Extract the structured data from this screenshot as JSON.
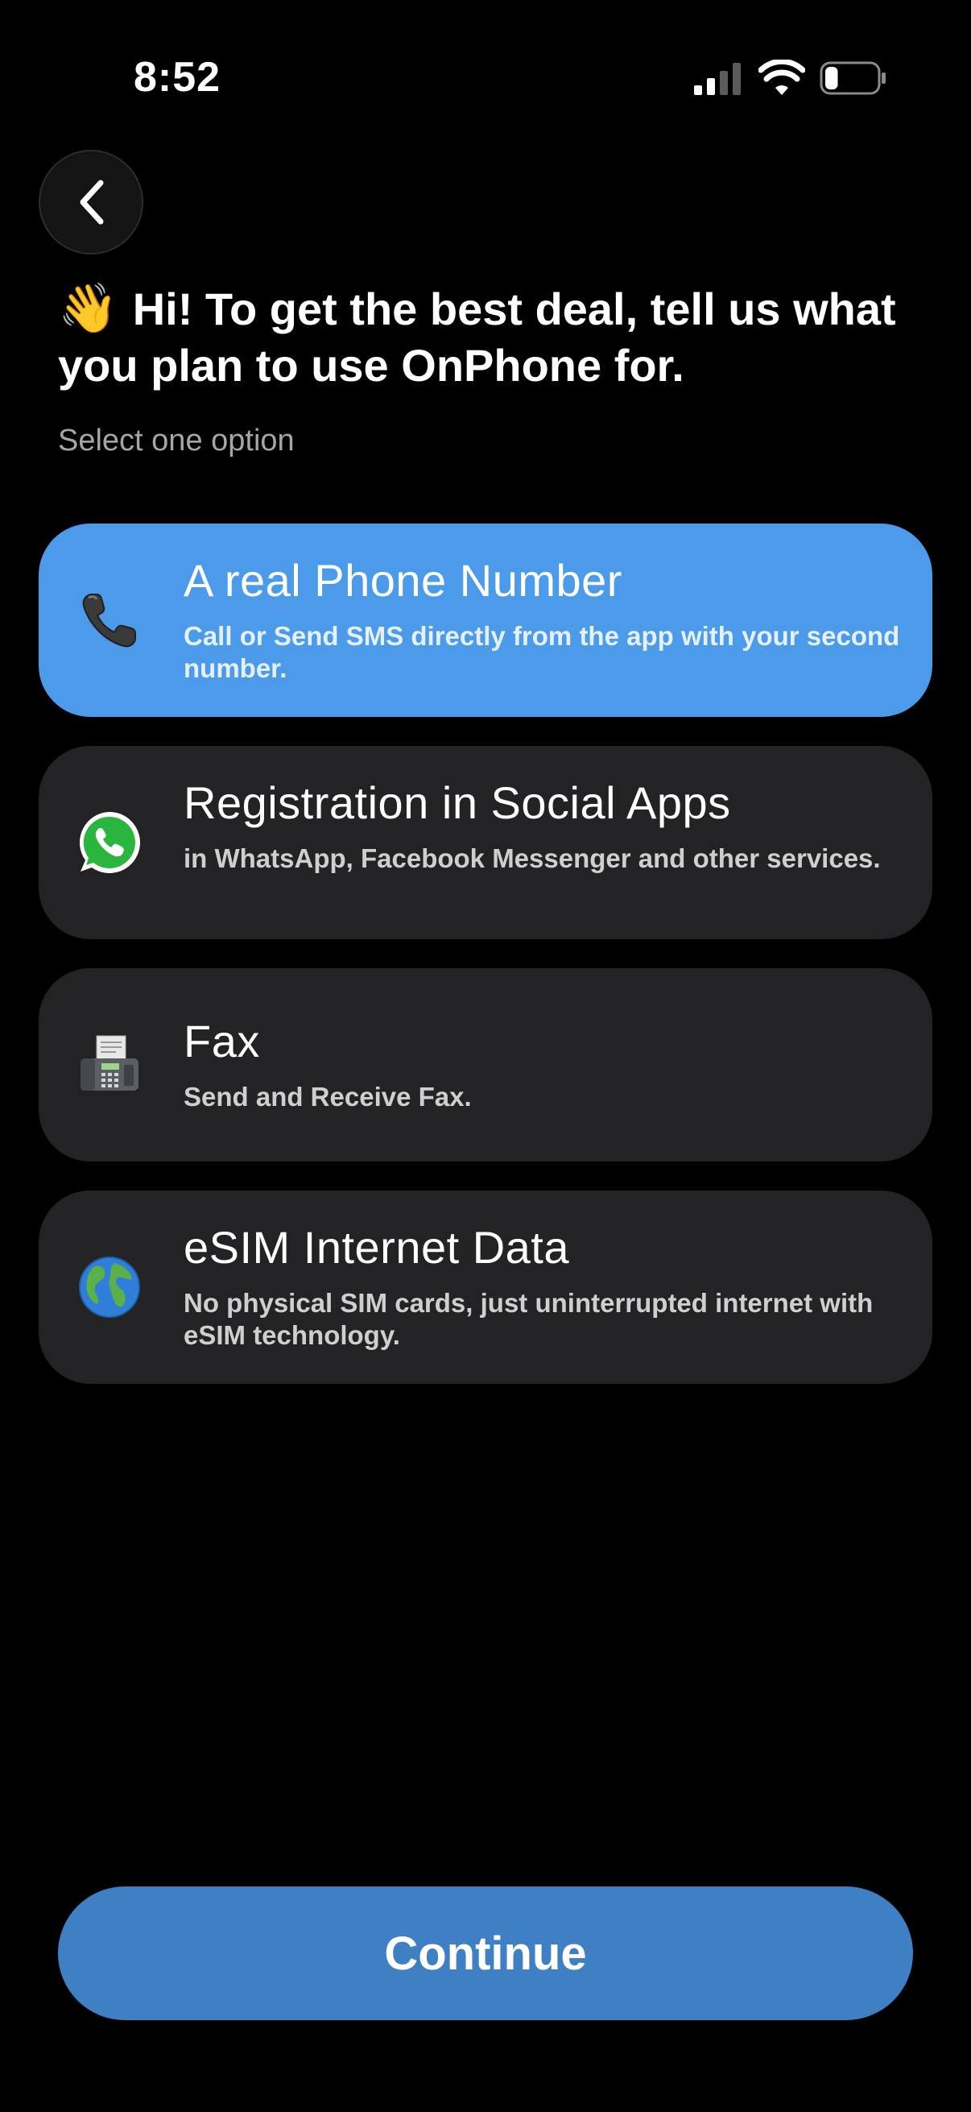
{
  "status_bar": {
    "time": "8:52",
    "signal_icon": "cellular-signal-icon",
    "wifi_icon": "wifi-icon",
    "battery_icon": "battery-icon",
    "battery_level": 0.25
  },
  "header": {
    "back_icon": "chevron-left-icon",
    "wave_emoji": "👋",
    "title": "Hi! To get the best deal, tell us what you plan to use OnPhone for.",
    "subtitle": "Select one option"
  },
  "options": [
    {
      "icon": "telephone-icon",
      "title": "A real Phone Number",
      "description": "Call or Send SMS directly from the app with your second number.",
      "selected": true
    },
    {
      "icon": "whatsapp-icon",
      "title": "Registration in Social Apps",
      "description": "in WhatsApp, Facebook Messenger and other services.",
      "selected": false
    },
    {
      "icon": "fax-machine-icon",
      "title": "Fax",
      "description": "Send and Receive Fax.",
      "selected": false
    },
    {
      "icon": "globe-icon",
      "title": "eSIM Internet Data",
      "description": "No physical SIM cards, just uninterrupted internet with eSIM technology.",
      "selected": false
    }
  ],
  "continue_label": "Continue",
  "colors": {
    "background": "#000000",
    "selected_option": "#4b9bea",
    "option": "#232325",
    "continue_button": "#3f80c4"
  }
}
